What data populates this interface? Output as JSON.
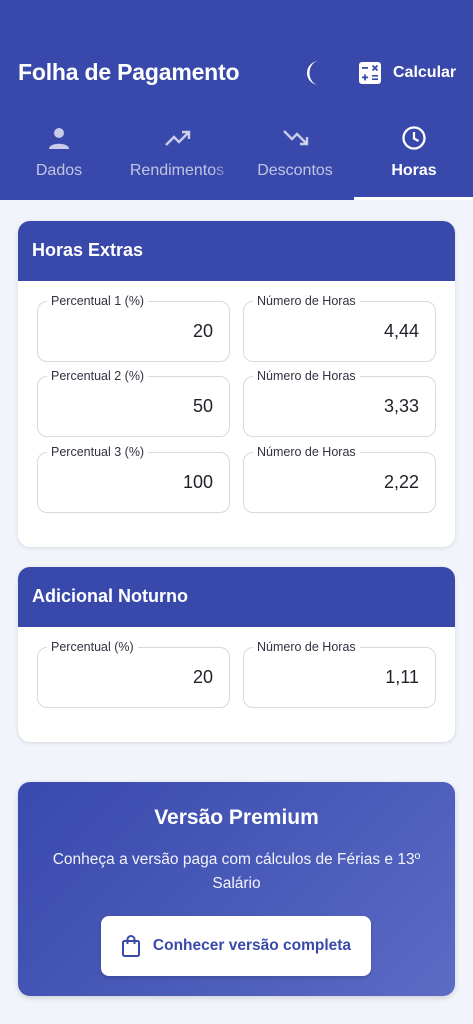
{
  "app": {
    "title": "Folha de Pagamento",
    "calc_label": "Calcular",
    "theme_icon": "moon-icon",
    "calc_icon": "calculator-icon"
  },
  "tabs": [
    {
      "label": "Dados",
      "icon": "person-icon"
    },
    {
      "label": "Rendimentos",
      "icon": "trending-up-icon"
    },
    {
      "label": "Descontos",
      "icon": "trending-down-icon"
    },
    {
      "label": "Horas",
      "icon": "clock-icon",
      "active": true
    }
  ],
  "horas_extras": {
    "title": "Horas Extras",
    "rows": [
      {
        "pct_label": "Percentual 1 (%)",
        "pct_value": "20",
        "hours_label": "Número de Horas",
        "hours_value": "4,44"
      },
      {
        "pct_label": "Percentual 2 (%)",
        "pct_value": "50",
        "hours_label": "Número de Horas",
        "hours_value": "3,33"
      },
      {
        "pct_label": "Percentual 3 (%)",
        "pct_value": "100",
        "hours_label": "Número de Horas",
        "hours_value": "2,22"
      }
    ]
  },
  "adicional_noturno": {
    "title": "Adicional Noturno",
    "pct_label": "Percentual (%)",
    "pct_value": "20",
    "hours_label": "Número de Horas",
    "hours_value": "1,11"
  },
  "premium": {
    "title": "Versão Premium",
    "text": "Conheça a versão paga com cálculos de Férias e 13º Salário",
    "button_label": "Conhecer versão completa",
    "button_icon": "shopping-bag-icon"
  },
  "colors": {
    "primary": "#3949ab",
    "background": "#f2f4fb",
    "card": "#ffffff",
    "field_border": "#d7d9df"
  }
}
